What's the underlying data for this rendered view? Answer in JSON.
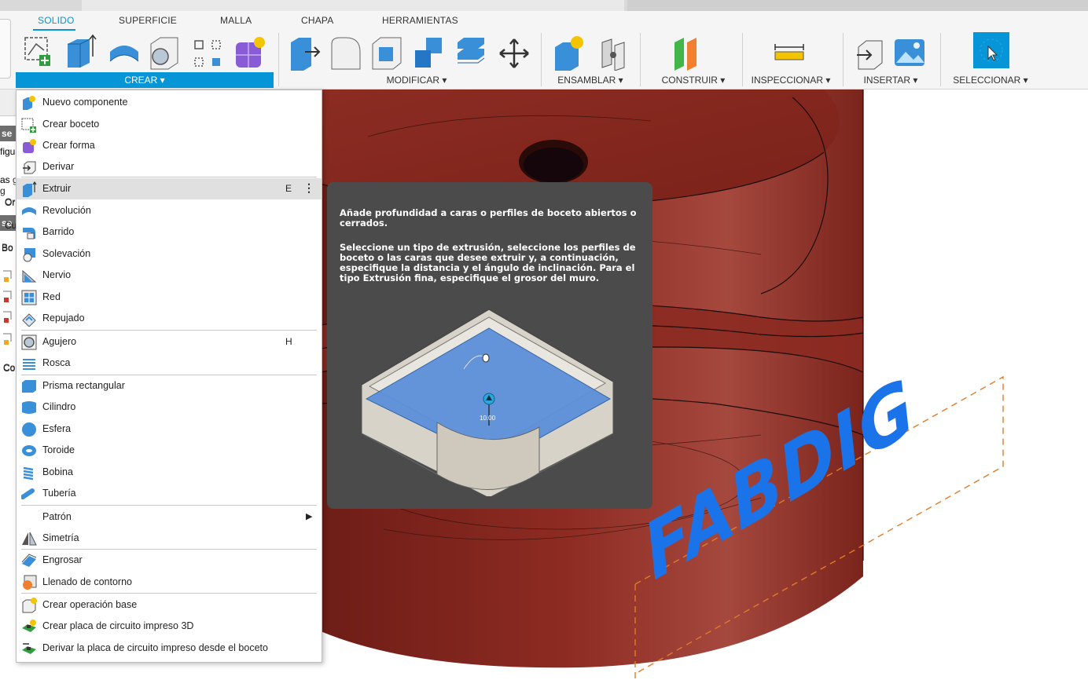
{
  "ribbon": {
    "tabs": [
      "SOLIDO",
      "SUPERFICIE",
      "MALLA",
      "CHAPA",
      "HERRAMIENTAS"
    ],
    "groups": [
      "CREAR ▾",
      "MODIFICAR ▾",
      "ENSAMBLAR ▾",
      "CONSTRUIR ▾",
      "INSPECCIONAR ▾",
      "INSERTAR ▾",
      "SELECCIONAR ▾"
    ]
  },
  "left_browser": {
    "items": [
      "se",
      "figu",
      "as g",
      "Or",
      "Cu",
      "Bo",
      "Co"
    ]
  },
  "menu": {
    "items": [
      {
        "label": "Nuevo componente",
        "icon": "new-component-icon"
      },
      {
        "label": "Crear boceto",
        "icon": "create-sketch-icon"
      },
      {
        "label": "Crear forma",
        "icon": "create-form-icon"
      },
      {
        "label": "Derivar",
        "icon": "derive-icon"
      },
      {
        "label": "Extruir",
        "icon": "extrude-icon",
        "shortcut": "E",
        "more": "⋮",
        "highlighted": true
      },
      {
        "label": "Revolución",
        "icon": "revolve-icon"
      },
      {
        "label": "Barrido",
        "icon": "sweep-icon"
      },
      {
        "label": "Solevación",
        "icon": "loft-icon"
      },
      {
        "label": "Nervio",
        "icon": "rib-icon"
      },
      {
        "label": "Red",
        "icon": "web-icon"
      },
      {
        "label": "Repujado",
        "icon": "emboss-icon"
      },
      {
        "label": "Agujero",
        "icon": "hole-icon",
        "shortcut": "H"
      },
      {
        "label": "Rosca",
        "icon": "thread-icon"
      },
      {
        "label": "Prisma rectangular",
        "icon": "box-icon"
      },
      {
        "label": "Cilindro",
        "icon": "cylinder-icon"
      },
      {
        "label": "Esfera",
        "icon": "sphere-icon"
      },
      {
        "label": "Toroide",
        "icon": "torus-icon"
      },
      {
        "label": "Bobina",
        "icon": "coil-icon"
      },
      {
        "label": "Tubería",
        "icon": "pipe-icon"
      },
      {
        "label": "Patrón",
        "icon": "",
        "submenu": "▶"
      },
      {
        "label": "Simetría",
        "icon": "mirror-icon"
      },
      {
        "label": "Engrosar",
        "icon": "thicken-icon"
      },
      {
        "label": "Llenado de contorno",
        "icon": "boundary-fill-icon"
      },
      {
        "label": "Crear operación base",
        "icon": "base-feature-icon"
      },
      {
        "label": "Crear placa de circuito impreso 3D",
        "icon": "pcb-create-icon"
      },
      {
        "label": "Derivar la placa de circuito impreso desde el boceto",
        "icon": "pcb-derive-icon"
      }
    ]
  },
  "tooltip": {
    "title": "Añade profundidad a caras o perfiles de boceto abiertos o cerrados.",
    "body": "Seleccione un tipo de extrusión, seleccione los perfiles de boceto o las caras que desee extruir y, a continuación, especifique la distancia y el ángulo de inclinación. Para el tipo Extrusión fina, especifique el grosor del muro.",
    "image_value": "10.00"
  },
  "viewport": {
    "watermark": "FABDIG",
    "model_color": "#8a2a22",
    "watermark_color": "#1a73e8"
  },
  "colors": {
    "accent": "#0696d7",
    "tooltip_bg": "#4b4b4b"
  }
}
